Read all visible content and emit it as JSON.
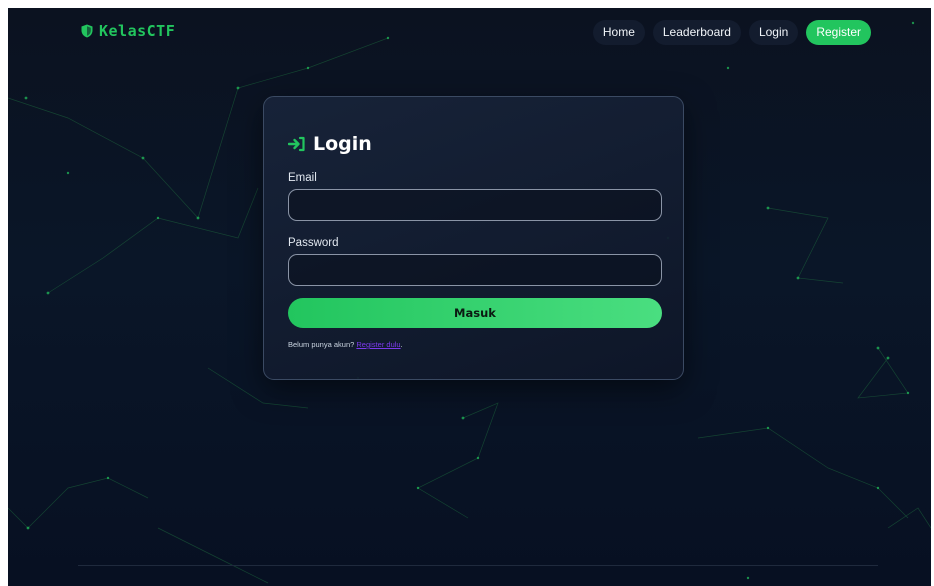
{
  "brand": {
    "name": "KelasCTF",
    "icon": "shield-icon",
    "color": "#22c55e"
  },
  "nav": {
    "items": [
      {
        "label": "Home"
      },
      {
        "label": "Leaderboard"
      },
      {
        "label": "Login"
      },
      {
        "label": "Register"
      }
    ]
  },
  "login": {
    "icon": "login-arrow-icon",
    "title": "Login",
    "email_label": "Email",
    "email_value": "",
    "password_label": "Password",
    "password_value": "",
    "submit_label": "Masuk",
    "prompt_text": "Belum punya akun?",
    "register_link": "Register dulu",
    "register_suffix": "."
  },
  "colors": {
    "accent": "#22c55e",
    "background": "#0a1628",
    "link": "#7c3aed"
  }
}
